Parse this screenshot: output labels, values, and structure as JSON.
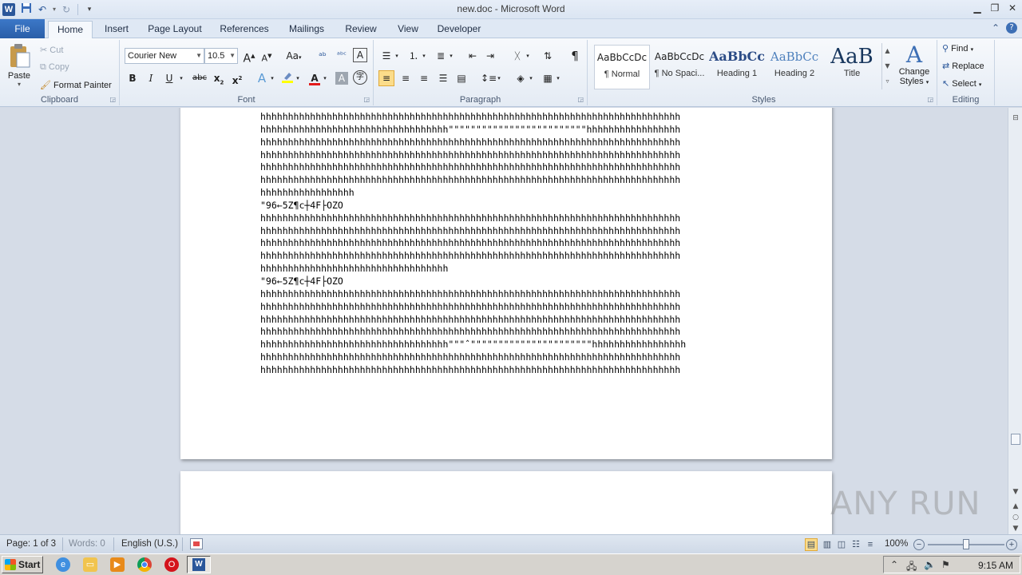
{
  "window": {
    "title": "new.doc - Microsoft Word",
    "app_icon": "word-icon",
    "quick_access": [
      "save-icon",
      "undo-icon",
      "redo-icon",
      "customize-icon"
    ]
  },
  "tabs": [
    "File",
    "Home",
    "Insert",
    "Page Layout",
    "References",
    "Mailings",
    "Review",
    "View",
    "Developer"
  ],
  "active_tab": "Home",
  "ribbon": {
    "clipboard": {
      "label": "Clipboard",
      "paste": "Paste",
      "cut": "Cut",
      "copy": "Copy",
      "format_painter": "Format Painter"
    },
    "font": {
      "label": "Font",
      "font_name": "Courier New",
      "font_size": "10.5",
      "grow": "A",
      "shrink": "A",
      "case": "Aa",
      "bold": "B",
      "italic": "I",
      "underline": "U",
      "strike": "abc",
      "subscript": "x",
      "subscript_mark": "2",
      "superscript": "x",
      "superscript_mark": "2",
      "font_color": "A",
      "char_shading": "A"
    },
    "paragraph": {
      "label": "Paragraph",
      "show_marks": "¶"
    },
    "styles": {
      "label": "Styles",
      "items": [
        {
          "preview": "AaBbCcDc",
          "name": "¶ Normal"
        },
        {
          "preview": "AaBbCcDc",
          "name": "¶ No Spaci..."
        },
        {
          "preview": "AaBbCc",
          "name": "Heading 1"
        },
        {
          "preview": "AaBbCc",
          "name": "Heading 2"
        },
        {
          "preview": "AaB",
          "name": "Title"
        }
      ],
      "selected": "¶ Normal",
      "change_styles_line1": "Change",
      "change_styles_line2": "Styles"
    },
    "editing": {
      "label": "Editing",
      "find": "Find",
      "replace": "Replace",
      "select": "Select"
    }
  },
  "document": {
    "lines": [
      "hhhhhhhhhhhhhhhhhhhhhhhhhhhhhhhhhhhhhhhhhhhhhhhhhhhhhhhhhhhhhhhhhhhhhhhhhhhh",
      "hhhhhhhhhhhhhhhhhhhhhhhhhhhhhhhhhh\"\"\"\"\"\"\"\"\"\"\"\"\"\"\"\"\"\"\"\"\"\"\"\"\"hhhhhhhhhhhhhhhhh",
      "hhhhhhhhhhhhhhhhhhhhhhhhhhhhhhhhhhhhhhhhhhhhhhhhhhhhhhhhhhhhhhhhhhhhhhhhhhhh",
      "hhhhhhhhhhhhhhhhhhhhhhhhhhhhhhhhhhhhhhhhhhhhhhhhhhhhhhhhhhhhhhhhhhhhhhhhhhhh",
      "hhhhhhhhhhhhhhhhhhhhhhhhhhhhhhhhhhhhhhhhhhhhhhhhhhhhhhhhhhhhhhhhhhhhhhhhhhhh",
      "hhhhhhhhhhhhhhhhhhhhhhhhhhhhhhhhhhhhhhhhhhhhhhhhhhhhhhhhhhhhhhhhhhhhhhhhhhhh",
      "hhhhhhhhhhhhhhhhh",
      "\"96←5Z¶c┼4F├OZO",
      "hhhhhhhhhhhhhhhhhhhhhhhhhhhhhhhhhhhhhhhhhhhhhhhhhhhhhhhhhhhhhhhhhhhhhhhhhhhh",
      "hhhhhhhhhhhhhhhhhhhhhhhhhhhhhhhhhhhhhhhhhhhhhhhhhhhhhhhhhhhhhhhhhhhhhhhhhhhh",
      "hhhhhhhhhhhhhhhhhhhhhhhhhhhhhhhhhhhhhhhhhhhhhhhhhhhhhhhhhhhhhhhhhhhhhhhhhhhh",
      "hhhhhhhhhhhhhhhhhhhhhhhhhhhhhhhhhhhhhhhhhhhhhhhhhhhhhhhhhhhhhhhhhhhhhhhhhhhh",
      "hhhhhhhhhhhhhhhhhhhhhhhhhhhhhhhhhh",
      "\"96←5Z¶c┼4F├OZO",
      "hhhhhhhhhhhhhhhhhhhhhhhhhhhhhhhhhhhhhhhhhhhhhhhhhhhhhhhhhhhhhhhhhhhhhhhhhhhh",
      "hhhhhhhhhhhhhhhhhhhhhhhhhhhhhhhhhhhhhhhhhhhhhhhhhhhhhhhhhhhhhhhhhhhhhhhhhhhh",
      "hhhhhhhhhhhhhhhhhhhhhhhhhhhhhhhhhhhhhhhhhhhhhhhhhhhhhhhhhhhhhhhhhhhhhhhhhhhh",
      "hhhhhhhhhhhhhhhhhhhhhhhhhhhhhhhhhhhhhhhhhhhhhhhhhhhhhhhhhhhhhhhhhhhhhhhhhhhh",
      "hhhhhhhhhhhhhhhhhhhhhhhhhhhhhhhhhh\"\"\"ˆ\"\"\"\"\"\"\"\"\"\"\"\"\"\"\"\"\"\"\"\"\"\"hhhhhhhhhhhhhhhhh",
      "hhhhhhhhhhhhhhhhhhhhhhhhhhhhhhhhhhhhhhhhhhhhhhhhhhhhhhhhhhhhhhhhhhhhhhhhhhhh",
      "hhhhhhhhhhhhhhhhhhhhhhhhhhhhhhhhhhhhhhhhhhhhhhhhhhhhhhhhhhhhhhhhhhhhhhhhhhhh"
    ]
  },
  "statusbar": {
    "page": "Page: 1 of 3",
    "words": "Words: 0",
    "language": "English (U.S.)",
    "zoom": "100%",
    "zoom_minus": "−",
    "zoom_plus": "+",
    "zoom_level": 1.0
  },
  "taskbar": {
    "start": "Start",
    "apps": [
      "ie-icon",
      "explorer-icon",
      "media-player-icon",
      "chrome-icon",
      "opera-icon",
      "word-icon"
    ],
    "clock": "9:15 AM"
  },
  "watermark": "ANY RUN",
  "colors": {
    "accent": "#2b579a",
    "file_tab": "#2a5ea8",
    "selection": "#fbdc8a"
  }
}
